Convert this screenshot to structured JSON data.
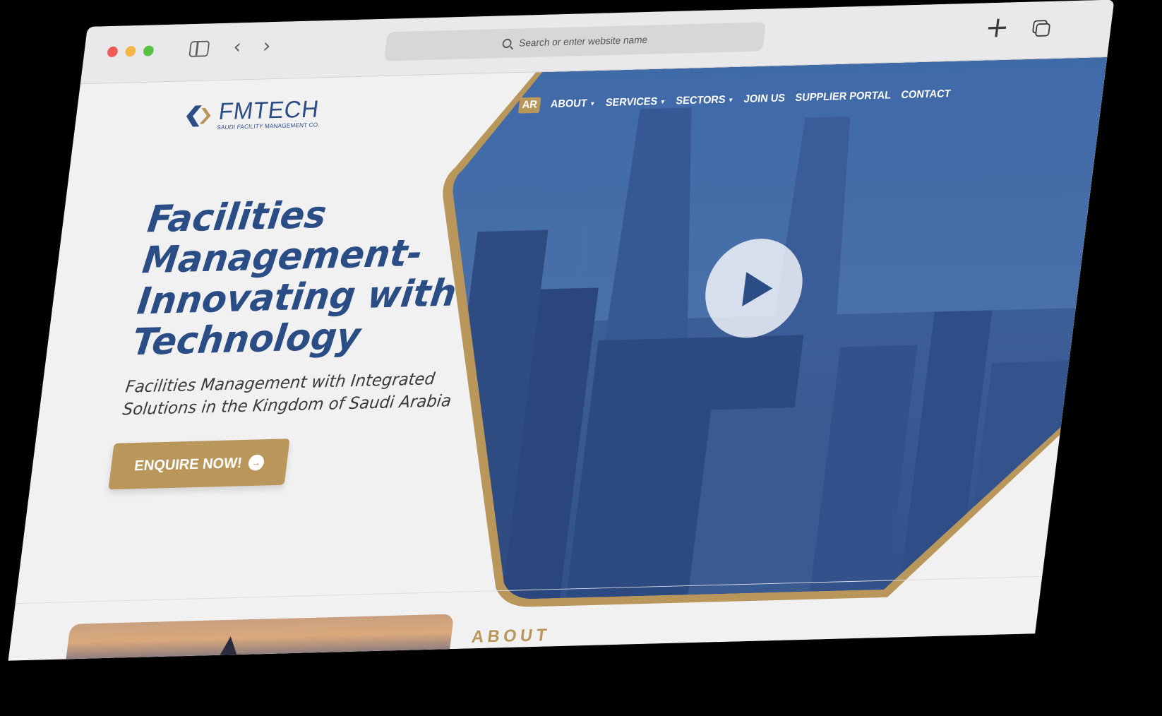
{
  "browser": {
    "url_placeholder": "Search or enter website name"
  },
  "site": {
    "logo_name": "FMTECH",
    "logo_subtitle": "SAUDI FACILITY MANAGEMENT CO.",
    "nav": {
      "lang": "AR",
      "items": [
        {
          "label": "ABOUT",
          "has_dropdown": true
        },
        {
          "label": "SERVICES",
          "has_dropdown": true
        },
        {
          "label": "SECTORS",
          "has_dropdown": true
        },
        {
          "label": "JOIN US",
          "has_dropdown": false
        },
        {
          "label": "SUPPLIER PORTAL",
          "has_dropdown": false
        },
        {
          "label": "CONTACT",
          "has_dropdown": false
        }
      ]
    },
    "hero": {
      "headline_lines": [
        "Facilities",
        "Management-",
        "Innovating with",
        "Technology"
      ],
      "subheadline": "Facilities Management with Integrated Solutions in the Kingdom of Saudi Arabia",
      "cta_label": "ENQUIRE NOW!",
      "play_icon": "play-icon"
    },
    "about_heading": "ABOUT"
  },
  "colors": {
    "brand_blue": "#2b4d86",
    "brand_gold": "#b9975b",
    "page_bg": "#f1f1f2"
  }
}
